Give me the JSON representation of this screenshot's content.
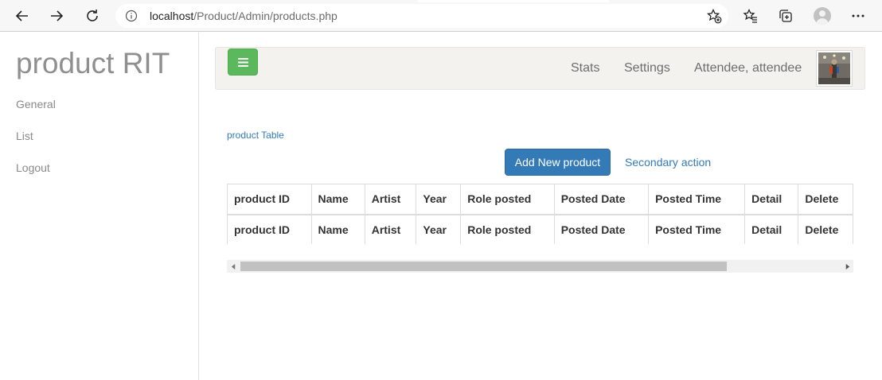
{
  "browser": {
    "url_host": "localhost",
    "url_path": "/Product/Admin/products.php"
  },
  "sidebar": {
    "brand": "product RIT",
    "items": [
      {
        "label": "General"
      },
      {
        "label": "List"
      },
      {
        "label": "Logout"
      }
    ]
  },
  "navbar": {
    "items": [
      {
        "label": "Stats"
      },
      {
        "label": "Settings"
      },
      {
        "label": "Attendee, attendee"
      }
    ]
  },
  "content": {
    "breadcrumb": "product Table",
    "add_button": "Add New product",
    "secondary_action": "Secondary action"
  },
  "table": {
    "header": [
      "product ID",
      "Name",
      "Artist",
      "Year",
      "Role posted",
      "Posted Date",
      "Posted Time",
      "Detail",
      "Delete"
    ],
    "footer": [
      "product ID",
      "Name",
      "Artist",
      "Year",
      "Role posted",
      "Posted Date",
      "Posted Time",
      "Detail",
      "Delete"
    ]
  },
  "colors": {
    "primary": "#337ab7",
    "success": "#5cb85c"
  }
}
